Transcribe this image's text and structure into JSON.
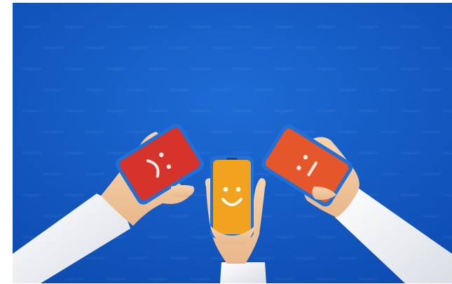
{
  "image": {
    "alt": "Three cartoon hands holding smartphones showing sad, smiling and neutral faces on a blue background",
    "watermark_text": "Unsplash+",
    "colors": {
      "background": "#1459c2",
      "phone_sad": "#d6342a",
      "phone_happy": "#f1a21f",
      "phone_neutral": "#e5562a",
      "phone_case": "#1d71d8",
      "skin": "#f0c49a",
      "sleeve": "#f3f4f6"
    },
    "faces": [
      "sad",
      "happy",
      "neutral"
    ]
  }
}
